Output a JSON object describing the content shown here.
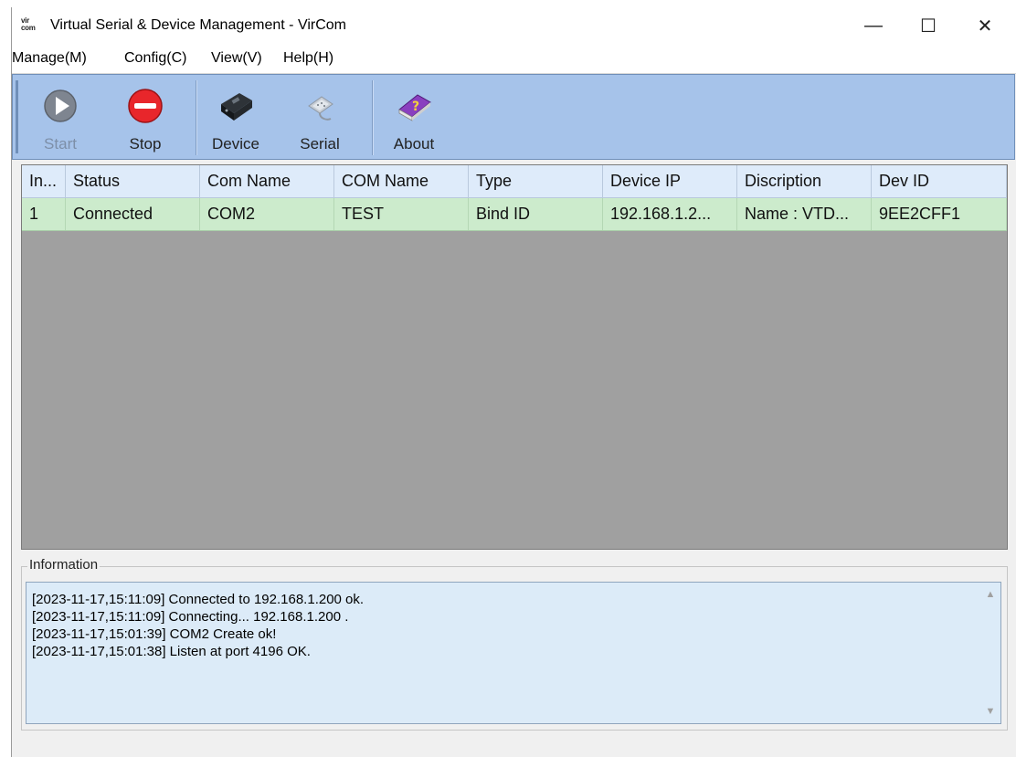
{
  "window": {
    "logo_text": "vir\ncom",
    "title": "Virtual Serial & Device Management - VirCom",
    "controls": {
      "minimize": "—",
      "maximize": "☐",
      "close": "✕"
    }
  },
  "menu": [
    {
      "label": "Manage(M)"
    },
    {
      "label": "Config(C)"
    },
    {
      "label": "View(V)"
    },
    {
      "label": "Help(H)"
    }
  ],
  "toolbar": {
    "buttons": [
      {
        "label": "Start",
        "icon": "play-icon",
        "enabled": false
      },
      {
        "label": "Stop",
        "icon": "stop-icon",
        "enabled": true
      },
      {
        "label": "Device",
        "icon": "device-icon",
        "enabled": true
      },
      {
        "label": "Serial",
        "icon": "serial-icon",
        "enabled": true
      },
      {
        "label": "About",
        "icon": "about-book-icon",
        "enabled": true
      }
    ]
  },
  "table": {
    "columns": [
      "In...",
      "Status",
      "Com Name",
      "COM Name",
      "Type",
      "Device IP",
      "Discription",
      "Dev ID"
    ],
    "rows": [
      [
        "1",
        "Connected",
        "COM2",
        "TEST",
        "Bind ID",
        "192.168.1.2...",
        "Name : VTD...",
        "9EE2CFF1"
      ]
    ],
    "row_color": "#ccebcc",
    "header_color": "#deebfa"
  },
  "information": {
    "title": "Information",
    "lines": [
      "[2023-11-17,15:11:09] Connected to 192.168.1.200 ok.",
      "[2023-11-17,15:11:09] Connecting... 192.168.1.200 .",
      "[2023-11-17,15:01:39] COM2 Create ok!",
      "[2023-11-17,15:01:38] Listen at port 4196 OK."
    ]
  },
  "colors": {
    "toolbar_bg": "#a6c3ea",
    "grid_bg": "#a0a0a0",
    "stop_red": "#e8262b",
    "about_purple": "#8a3fbf"
  }
}
